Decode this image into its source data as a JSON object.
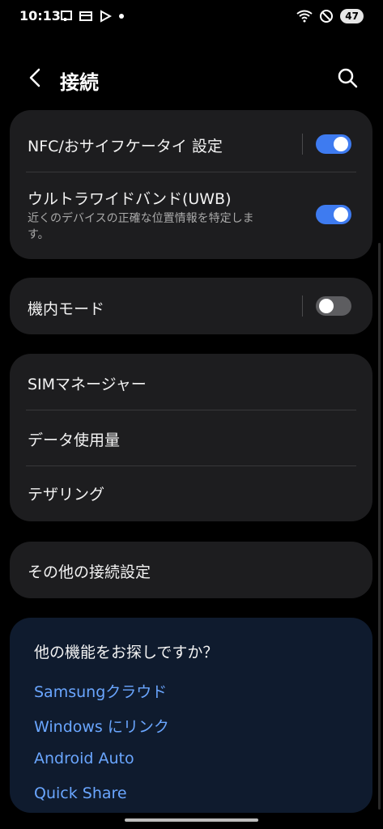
{
  "status": {
    "time": "10:13",
    "battery": "47"
  },
  "header": {
    "title": "接続"
  },
  "group1": {
    "nfc_label": "NFC/おサイフケータイ 設定",
    "nfc_on": true,
    "uwb_label": "ウルトラワイドバンド(UWB)",
    "uwb_desc": "近くのデバイスの正確な位置情報を特定します。",
    "uwb_on": true
  },
  "group2": {
    "airplane_label": "機内モード",
    "airplane_on": false
  },
  "group3": {
    "sim_label": "SIMマネージャー",
    "data_label": "データ使用量",
    "tether_label": "テザリング"
  },
  "group4": {
    "other_label": "その他の接続設定"
  },
  "suggestions": {
    "title": "他の機能をお探しですか？",
    "links": [
      "Samsungクラウド",
      "Windows にリンク",
      "Android Auto",
      "Quick Share"
    ]
  },
  "colors": {
    "accent": "#3e7bf0",
    "link": "#6aa6ff",
    "card": "#1d1d1f",
    "suggest_bg": "#0f1b2e"
  },
  "icons": [
    "wifi-icon",
    "mute-icon",
    "back-icon",
    "search-icon"
  ]
}
